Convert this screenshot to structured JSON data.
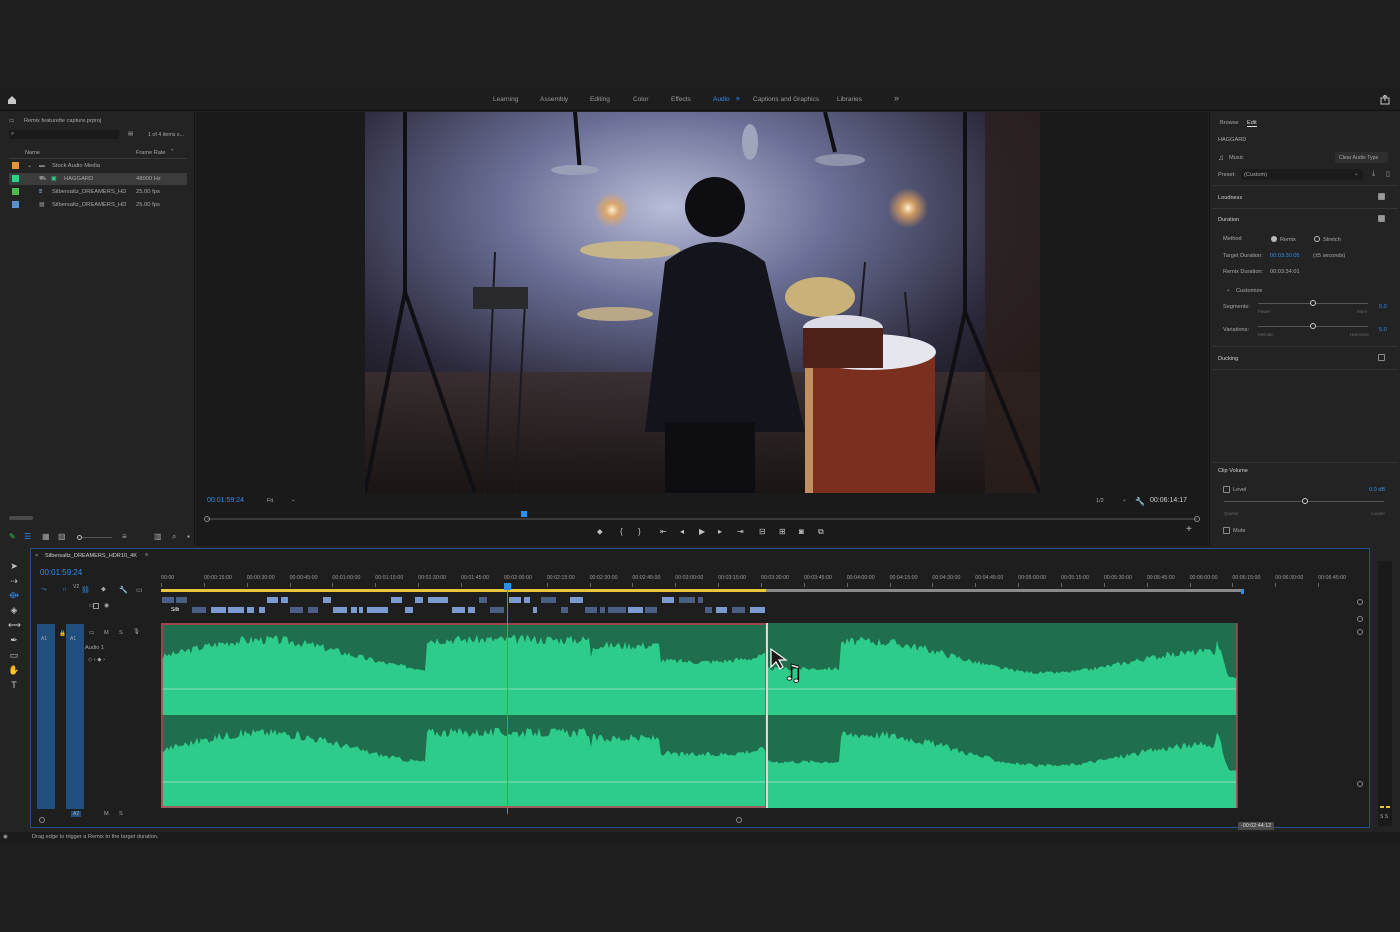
{
  "workspace_tabs": [
    "Learning",
    "Assembly",
    "Editing",
    "Color",
    "Effects",
    "Audio",
    "Captions and Graphics",
    "Libraries"
  ],
  "active_tab": "Audio",
  "overflow_label": "»",
  "project": {
    "title": "Remix featurette capture.prproj",
    "items_count": "1 of 4 items s...",
    "col_name": "Name",
    "col_rate": "Frame Rate",
    "rows": [
      {
        "name": "Stock Audio Media",
        "rate": "",
        "color": "#e8923a"
      },
      {
        "name": "HAGGARD",
        "rate": "48000 Hz",
        "color": "#2ed08a"
      },
      {
        "name": "Silbersaltz_DREAMERS_HD",
        "rate": "25.00 fps",
        "color": "#4fb84f"
      },
      {
        "name": "Silbersaltz_DREAMERS_HD",
        "rate": "25.00 fps",
        "color": "#5a8fd0"
      }
    ]
  },
  "monitor": {
    "timecode": "00:01:59:24",
    "fit": "Fit",
    "resolution": "1/2",
    "duration": "00:06:14:17",
    "playhead_fraction": 0.32
  },
  "essential_sound": {
    "tab_browse": "Browse",
    "tab_edit": "Edit",
    "clip_name": "HAGGARD",
    "type": "Music",
    "clear_btn": "Clear Audio Type",
    "preset_label": "Preset:",
    "preset_value": "(Custom)",
    "loudness": "Loudness",
    "duration": "Duration",
    "method_label": "Method",
    "method_remix": "Remix",
    "method_stretch": "Stretch",
    "target_label": "Target Duration:",
    "target_value": "00:03:30:05",
    "target_tol": "(±5 seconds)",
    "remix_label": "Remix Duration:",
    "remix_value": "00:03:34:01",
    "customize": "Customize",
    "segments_label": "Segments:",
    "segments_value": "5.0",
    "segments_min": "Fewer",
    "segments_max": "More",
    "variations_label": "Variations:",
    "variations_value": "5.0",
    "variations_min": "Melodic",
    "variations_max": "Harmonic",
    "ducking": "Ducking",
    "clip_volume": "Clip Volume",
    "level": "Level",
    "level_value": "0.0 dB",
    "level_min": "Quieter",
    "level_max": "Louder",
    "mute": "Mute"
  },
  "timeline": {
    "sequence": "Silbersaltz_DREAMERS_HDR10_4K",
    "timecode": "00:01:59:24",
    "ruler": [
      "00:00",
      "00:00:15:00",
      "00:00:30:00",
      "00:00:45:00",
      "00:01:00:00",
      "00:01:15:00",
      "00:01:30:00",
      "00:01:45:00",
      "00:02:00:00",
      "00:02:15:00",
      "00:02:30:00",
      "00:02:45:00",
      "00:03:00:00",
      "00:03:15:00",
      "00:03:30:00",
      "00:03:45:00",
      "00:04:00:00",
      "00:04:15:00",
      "00:04:30:00",
      "00:04:45:00",
      "00:05:00:00",
      "00:05:15:00",
      "00:05:30:00",
      "00:05:45:00",
      "00:06:00:00",
      "00:06:15:00",
      "00:06:30:00",
      "00:06:45:00"
    ],
    "track_v2": "V2",
    "track_a1": "A1",
    "track_a2": "A2",
    "audio_name": "Audio 1",
    "clip_label": "Silb",
    "offset_badge": "-00:02:44:12"
  },
  "status_text": "Drag edge to trigger a Remix to the target duration.",
  "colors": {
    "accent": "#2e8ef0",
    "audio_clip": "#2ecc8a",
    "audio_dark": "#1f6f4e",
    "selection": "#c03a52"
  }
}
